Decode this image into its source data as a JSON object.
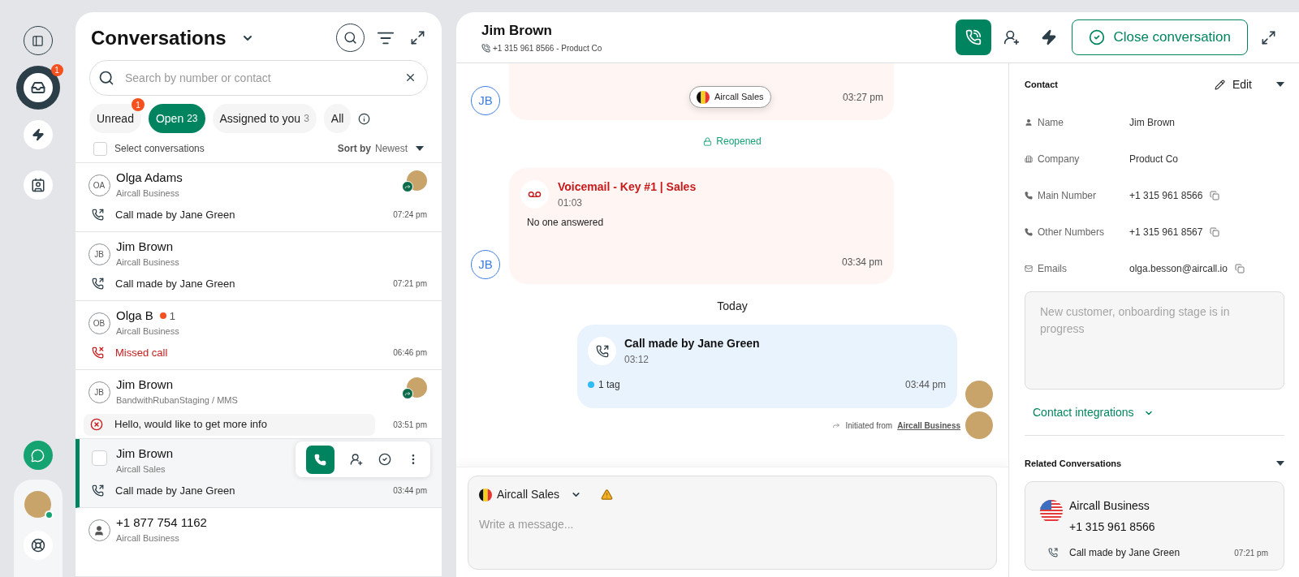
{
  "rail": {
    "inbox_badge": "1"
  },
  "conversations": {
    "title": "Conversations",
    "search": {
      "placeholder": "Search by number or contact"
    },
    "filters": [
      {
        "label": "Unread",
        "badge": "1",
        "selected": false
      },
      {
        "label": "Open",
        "count": "23",
        "selected": true
      },
      {
        "label": "Assigned to you",
        "count": "3",
        "selected": false
      },
      {
        "label": "All",
        "selected": false
      }
    ],
    "select_label": "Select conversations",
    "select_all_checked": false,
    "sort_label": "Sort by",
    "sort_value": "Newest",
    "items": [
      {
        "avatar": {
          "kind": "initials",
          "initials": "OA"
        },
        "name": "Olga Adams",
        "source": "Aircall Business",
        "preview": {
          "kind": "call",
          "text": "Call made by Jane Green"
        },
        "time": "07:24 pm",
        "assigned": true,
        "selected": false
      },
      {
        "avatar": {
          "kind": "initials",
          "initials": "JB"
        },
        "name": "Jim Brown",
        "source": "Aircall Business",
        "preview": {
          "kind": "call",
          "text": "Call made by Jane Green"
        },
        "time": "07:21 pm",
        "assigned": false,
        "selected": false
      },
      {
        "avatar": {
          "kind": "initials",
          "initials": "OB"
        },
        "name": "Olga B",
        "unread": "1",
        "source": "Aircall Business",
        "preview": {
          "kind": "missed",
          "text": "Missed call"
        },
        "time": "06:46 pm",
        "assigned": false,
        "selected": false
      },
      {
        "avatar": {
          "kind": "initials",
          "initials": "JB"
        },
        "name": "Jim Brown",
        "source": "BandwithRubanStaging / MMS",
        "preview": {
          "kind": "failed_message",
          "text": "Hello, would like to get more info"
        },
        "time": "03:51 pm",
        "assigned": true,
        "selected": false
      },
      {
        "avatar": {
          "kind": "checkbox",
          "checked": false
        },
        "name": "Jim Brown",
        "source": "Aircall Sales",
        "preview": {
          "kind": "call",
          "text": "Call made by Jane Green"
        },
        "time": "03:44 pm",
        "assigned": false,
        "selected": true
      },
      {
        "avatar": {
          "kind": "person"
        },
        "name": "+1 877 754 1162",
        "source": "Aircall Business",
        "assigned": false,
        "selected": false
      }
    ]
  },
  "header": {
    "name": "Jim Brown",
    "subtitle": "+1 315 961 8566 - Product Co",
    "close_label": "Close conversation"
  },
  "messages": [
    {
      "kind": "partial_bubble",
      "chip": "Aircall Sales",
      "time": "03:27 pm",
      "avatar": "JB"
    },
    {
      "kind": "event",
      "text": "Reopened"
    },
    {
      "kind": "voicemail",
      "title": "Voicemail - Key #1 | Sales",
      "duration": "01:03",
      "body": "No one answered",
      "time": "03:34 pm",
      "avatar": "JB"
    },
    {
      "kind": "divider",
      "text": "Today"
    },
    {
      "kind": "outgoing_call",
      "title": "Call made by Jane Green",
      "duration": "03:12",
      "tag": {
        "label": "1 tag",
        "color": "#2ebcf5"
      },
      "time": "03:44 pm"
    },
    {
      "kind": "initiated",
      "prefix": "Initiated from",
      "link": "Aircall Business"
    }
  ],
  "composer": {
    "line": "Aircall Sales",
    "placeholder": "Write a message..."
  },
  "contact": {
    "title": "Contact",
    "edit": "Edit",
    "fields": [
      {
        "kind": "name",
        "label": "Name",
        "value": "Jim Brown"
      },
      {
        "kind": "company",
        "label": "Company",
        "value": "Product Co"
      },
      {
        "kind": "phone",
        "label": "Main Number",
        "value": "+1 315 961 8566"
      },
      {
        "kind": "phone",
        "label": "Other Numbers",
        "value": "+1 315 961 8567"
      },
      {
        "kind": "email",
        "label": "Emails",
        "value": "olga.besson@aircall.io"
      }
    ],
    "note": {
      "placeholder": "New customer, onboarding stage is in progress"
    },
    "integrations": "Contact integrations"
  },
  "related": {
    "title": "Related Conversations",
    "items": [
      {
        "line": "Aircall Business",
        "number": "+1 315 961 8566",
        "preview": "Call made by Jane Green",
        "time": "07:21 pm"
      }
    ]
  }
}
